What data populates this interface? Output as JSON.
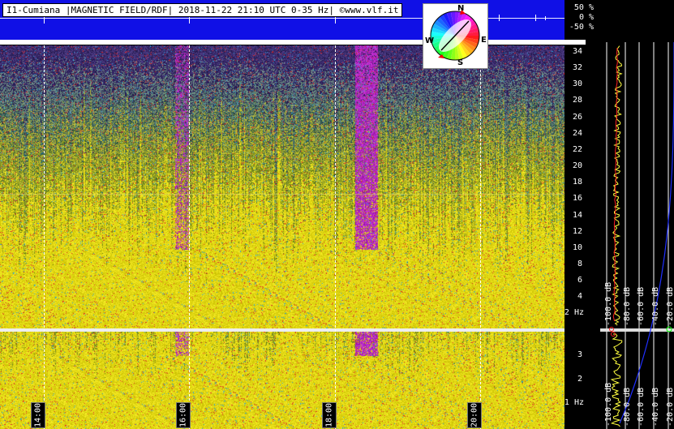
{
  "header": {
    "title": "I1-Cumiana |MAGNETIC FIELD/RDF| 2018-11-22 21:10 UTC 0-35 Hz| ©www.vlf.it",
    "percent_scale": [
      "50 %",
      "0 %",
      "-50 %"
    ]
  },
  "compass": {
    "n": "N",
    "e": "E",
    "s": "S",
    "w": "W"
  },
  "freq_axis_top": [
    "34",
    "32",
    "30",
    "28",
    "26",
    "24",
    "22",
    "20",
    "18",
    "16",
    "14",
    "12",
    "10",
    "8",
    "6",
    "4",
    "2 Hz"
  ],
  "freq_axis_bottom": [
    "3",
    "2",
    "1 Hz"
  ],
  "time_labels": [
    "14:00",
    "16:00",
    "18:00",
    "20:00"
  ],
  "db_scale_top": [
    "-100.0 dB",
    "-80.0 dB",
    "-60.0 dB",
    "-40.0 dB",
    "-20.0 dB"
  ],
  "db_scale_bottom": [
    "-100.0 dB",
    "-80.0 dB",
    "-60.0 dB",
    "-40.0 dB",
    "-20.0 dB"
  ],
  "colors": {
    "header_bg": "#1010e6",
    "background": "#000000",
    "trace": "#ffff40",
    "marker": "#ff2020",
    "log_curve": "#2030ff"
  }
}
